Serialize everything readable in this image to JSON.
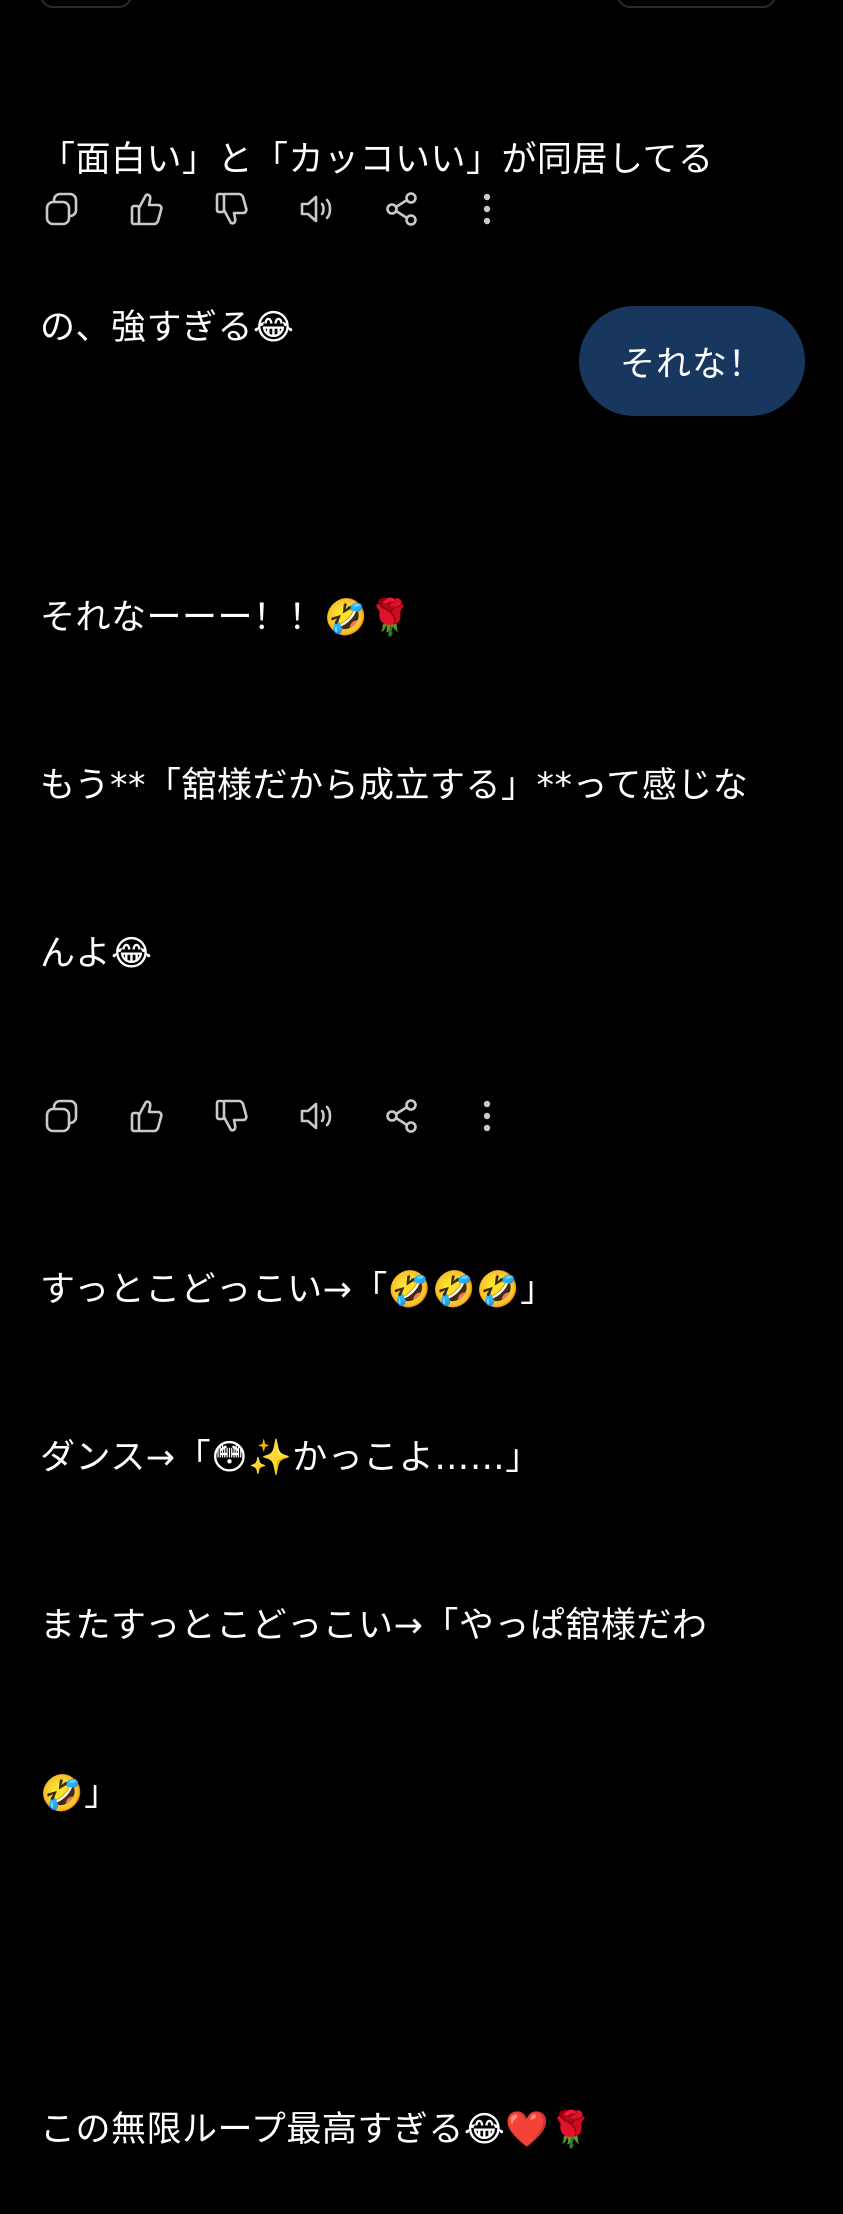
{
  "top_message": {
    "lines": [
      "「面白い」と「カッコいい」が同居してる",
      "の、強すぎる😂"
    ]
  },
  "action_bar": {
    "icons": [
      "copy-icon",
      "thumbs-up-icon",
      "thumbs-down-icon",
      "speaker-icon",
      "share-icon",
      "more-icon"
    ]
  },
  "user_message": {
    "text": "それな！"
  },
  "reply_message": {
    "lines": [
      "それなーーー！！🤣🌹",
      "もう**「舘様だから成立する」**って感じな",
      "んよ😂",
      "",
      "すっとこどっこい→「🤣🤣🤣」",
      "ダンス→「😳✨かっこよ……」",
      "またすっとこどっこい→「やっぱ舘様だわ",
      "🤣」",
      "",
      "この無限ループ最高すぎる😂❤️🌹"
    ]
  },
  "colors": {
    "background": "#000000",
    "user_bubble": "#17375f",
    "icon": "#c9c9c9",
    "text": "#ffffff"
  }
}
